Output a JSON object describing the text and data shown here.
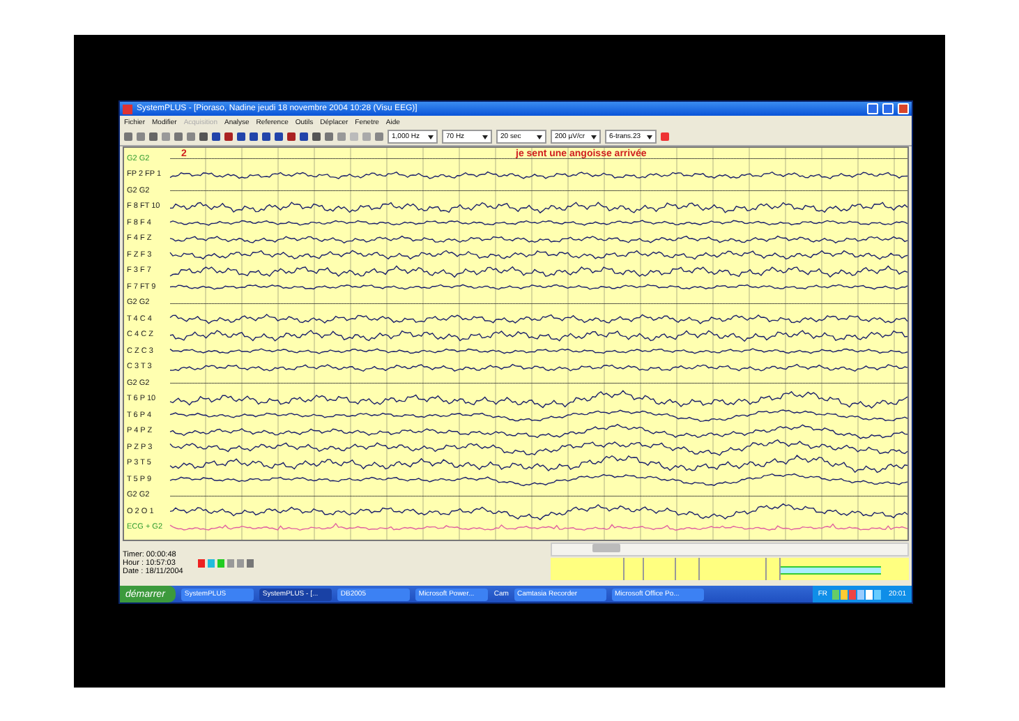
{
  "window": {
    "title": "SystemPLUS - [Pioraso, Nadine jeudi 18 novembre 2004 10:28 (Visu EEG)]"
  },
  "menu": [
    {
      "label": "Fichier",
      "disabled": false
    },
    {
      "label": "Modifier",
      "disabled": false
    },
    {
      "label": "Acquisition",
      "disabled": true
    },
    {
      "label": "Analyse",
      "disabled": false
    },
    {
      "label": "Reference",
      "disabled": false
    },
    {
      "label": "Outils",
      "disabled": false
    },
    {
      "label": "Déplacer",
      "disabled": false
    },
    {
      "label": "Fenetre",
      "disabled": false
    },
    {
      "label": "Aide",
      "disabled": false
    }
  ],
  "toolbar": {
    "dropdowns": [
      "1,000 Hz",
      "70 Hz",
      "20 sec",
      "200 µV/cr",
      "6-trans.23"
    ]
  },
  "annotations": {
    "marker": "2",
    "event": "je sent une angoisse arrivée"
  },
  "channels": [
    {
      "label": "G2 G2",
      "kind": "reference"
    },
    {
      "label": "FP 2 FP 1",
      "kind": "eeg"
    },
    {
      "label": "G2 G2",
      "kind": "flat"
    },
    {
      "label": "F 8 FT 10",
      "kind": "eeg"
    },
    {
      "label": "F 8 F 4",
      "kind": "eeg"
    },
    {
      "label": "F 4 F Z",
      "kind": "eeg"
    },
    {
      "label": "F Z F 3",
      "kind": "eeg"
    },
    {
      "label": "F 3 F 7",
      "kind": "eeg"
    },
    {
      "label": "F 7 FT 9",
      "kind": "eeg"
    },
    {
      "label": "G2 G2",
      "kind": "flat"
    },
    {
      "label": "T 4 C 4",
      "kind": "eeg"
    },
    {
      "label": "C 4 C Z",
      "kind": "eeg"
    },
    {
      "label": "C Z C 3",
      "kind": "eeg"
    },
    {
      "label": "C 3 T 3",
      "kind": "eeg"
    },
    {
      "label": "G2 G2",
      "kind": "flat"
    },
    {
      "label": "T 6 P 10",
      "kind": "eeg"
    },
    {
      "label": "T 6 P 4",
      "kind": "eeg"
    },
    {
      "label": "P 4 P Z",
      "kind": "eeg"
    },
    {
      "label": "P Z P 3",
      "kind": "eeg"
    },
    {
      "label": "P 3 T 5",
      "kind": "eeg"
    },
    {
      "label": "T 5 P 9",
      "kind": "eeg"
    },
    {
      "label": "G2 G2",
      "kind": "flat"
    },
    {
      "label": "O 2 O 1",
      "kind": "eeg"
    },
    {
      "label": "ECG + G2",
      "kind": "ecg"
    }
  ],
  "status": [
    {
      "label": "Timer:",
      "value": "00:00:48"
    },
    {
      "label": "Hour :",
      "value": "10:57:03"
    },
    {
      "label": "Date :",
      "value": "18/11/2004"
    }
  ],
  "taskbar": {
    "start": "démarrer",
    "tasks": [
      {
        "label": "SystemPLUS",
        "selected": false
      },
      {
        "label": "SystemPLUS - [...",
        "selected": true
      },
      {
        "label": "DB2005",
        "selected": false
      },
      {
        "label": "Microsoft Power...",
        "selected": false
      }
    ],
    "tray_label": "Cam",
    "tray_tasks": [
      "Camtasia Recorder",
      "Microsoft Office Po..."
    ],
    "language": "FR",
    "clock": "20:01"
  }
}
